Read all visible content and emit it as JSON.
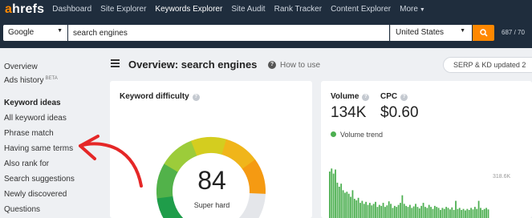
{
  "brand": {
    "logo_a": "a",
    "logo_rest": "hrefs"
  },
  "nav": {
    "items": [
      "Dashboard",
      "Site Explorer",
      "Keywords Explorer",
      "Site Audit",
      "Rank Tracker",
      "Content Explorer"
    ],
    "more": "More",
    "active": "Keywords Explorer"
  },
  "search": {
    "engine": "Google",
    "query": "search engines",
    "country": "United States",
    "credits": "687 / 70"
  },
  "sidebar": {
    "overview": "Overview",
    "ads_history": "Ads history",
    "ads_badge": "BETA",
    "section_title": "Keyword ideas",
    "items": [
      "All keyword ideas",
      "Phrase match",
      "Having same terms",
      "Also rank for",
      "Search suggestions",
      "Newly discovered",
      "Questions"
    ]
  },
  "header": {
    "title": "Overview: search engines",
    "how_to": "How to use",
    "serp_badge": "SERP & KD updated 2"
  },
  "kd_card": {
    "title": "Keyword difficulty",
    "value": "84",
    "value_fraction": 0.84,
    "label": "Super hard"
  },
  "volume_card": {
    "volume_label": "Volume",
    "cpc_label": "CPC",
    "volume": "134K",
    "cpc": "$0.60",
    "trend_label": "Volume trend",
    "axis_max": "318.6K",
    "trend_values": [
      0.92,
      0.98,
      0.88,
      0.96,
      0.7,
      0.62,
      0.68,
      0.55,
      0.5,
      0.52,
      0.48,
      0.42,
      0.55,
      0.38,
      0.35,
      0.4,
      0.3,
      0.34,
      0.28,
      0.32,
      0.26,
      0.3,
      0.25,
      0.28,
      0.32,
      0.22,
      0.26,
      0.24,
      0.3,
      0.22,
      0.25,
      0.33,
      0.28,
      0.2,
      0.24,
      0.22,
      0.26,
      0.3,
      0.45,
      0.28,
      0.24,
      0.22,
      0.26,
      0.2,
      0.23,
      0.28,
      0.22,
      0.19,
      0.24,
      0.3,
      0.22,
      0.2,
      0.26,
      0.22,
      0.18,
      0.24,
      0.22,
      0.2,
      0.16,
      0.2,
      0.18,
      0.22,
      0.2,
      0.17,
      0.21,
      0.16,
      0.34,
      0.18,
      0.2,
      0.16,
      0.18,
      0.15,
      0.18,
      0.16,
      0.2,
      0.17,
      0.22,
      0.18,
      0.34,
      0.2,
      0.16,
      0.18,
      0.2,
      0.17
    ],
    "bar_color": "#4caf50"
  },
  "colors": {
    "accent": "#ff8800",
    "nav_bg": "#1f2d3d",
    "annotation": "#e52727"
  }
}
